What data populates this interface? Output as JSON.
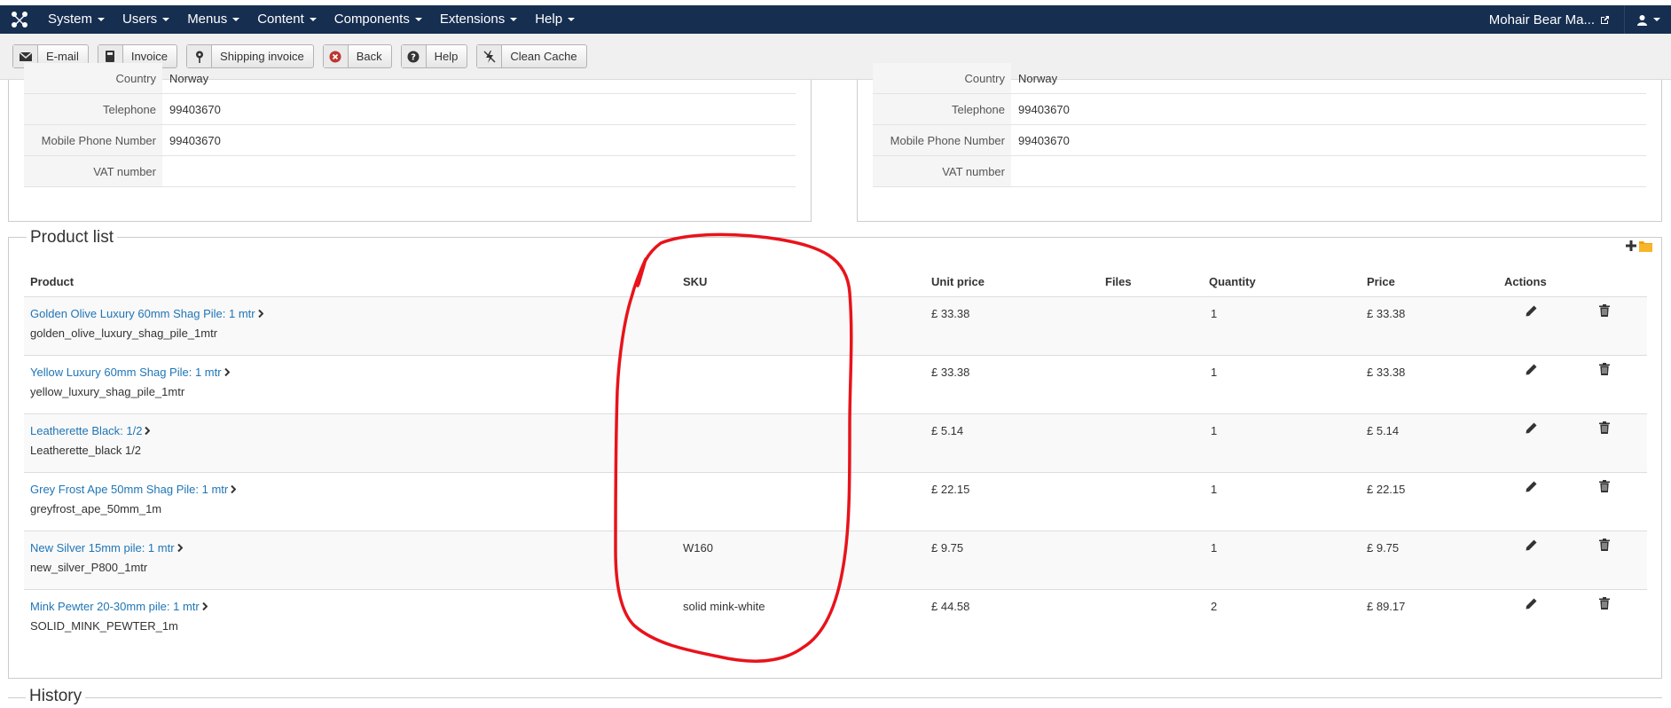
{
  "topbar": {
    "menu": [
      {
        "label": "System"
      },
      {
        "label": "Users"
      },
      {
        "label": "Menus"
      },
      {
        "label": "Content"
      },
      {
        "label": "Components"
      },
      {
        "label": "Extensions"
      },
      {
        "label": "Help"
      }
    ],
    "site_name": "Mohair Bear Ma...",
    "bar_color": "#162e50"
  },
  "toolbar": {
    "buttons": [
      {
        "label": "E-mail",
        "icon": "envelope-icon"
      },
      {
        "label": "Invoice",
        "icon": "book-icon"
      },
      {
        "label": "Shipping invoice",
        "icon": "map-pin-icon"
      },
      {
        "label": "Back",
        "icon": "cancel-circle-icon"
      },
      {
        "label": "Help",
        "icon": "question-circle-icon"
      },
      {
        "label": "Clean Cache",
        "icon": "flash-off-icon"
      }
    ]
  },
  "billing": {
    "rows": [
      {
        "label": "Country",
        "value": "Norway"
      },
      {
        "label": "Telephone",
        "value": "99403670"
      },
      {
        "label": "Mobile Phone Number",
        "value": "99403670"
      },
      {
        "label": "VAT number",
        "value": ""
      }
    ]
  },
  "shipping": {
    "rows": [
      {
        "label": "Country",
        "value": "Norway"
      },
      {
        "label": "Telephone",
        "value": "99403670"
      },
      {
        "label": "Mobile Phone Number",
        "value": "99403670"
      },
      {
        "label": "VAT number",
        "value": ""
      }
    ]
  },
  "product_list": {
    "legend": "Product list",
    "columns": {
      "product": "Product",
      "sku": "SKU",
      "unit_price": "Unit price",
      "files": "Files",
      "quantity": "Quantity",
      "price": "Price",
      "actions": "Actions"
    },
    "rows": [
      {
        "name": "Golden Olive Luxury 60mm Shag Pile: 1 mtr",
        "code": "golden_olive_luxury_shag_pile_1mtr",
        "sku": "",
        "unit_price": "£ 33.38",
        "quantity": "1",
        "price": "£ 33.38"
      },
      {
        "name": "Yellow Luxury 60mm Shag Pile: 1 mtr",
        "code": "yellow_luxury_shag_pile_1mtr",
        "sku": "",
        "unit_price": "£ 33.38",
        "quantity": "1",
        "price": "£ 33.38"
      },
      {
        "name": "Leatherette Black: 1/2",
        "code": "Leatherette_black 1/2",
        "sku": "",
        "unit_price": "£ 5.14",
        "quantity": "1",
        "price": "£ 5.14"
      },
      {
        "name": "Grey Frost Ape 50mm Shag Pile: 1 mtr",
        "code": "greyfrost_ape_50mm_1m",
        "sku": "",
        "unit_price": "£ 22.15",
        "quantity": "1",
        "price": "£ 22.15"
      },
      {
        "name": "New Silver 15mm pile: 1 mtr",
        "code": "new_silver_P800_1mtr",
        "sku": "W160",
        "unit_price": "£ 9.75",
        "quantity": "1",
        "price": "£ 9.75"
      },
      {
        "name": "Mink Pewter 20-30mm pile: 1 mtr",
        "code": "SOLID_MINK_PEWTER_1m",
        "sku": "solid mink-white",
        "unit_price": "£ 44.58",
        "quantity": "2",
        "price": "£ 89.17"
      }
    ]
  },
  "history": {
    "legend": "History"
  },
  "colors": {
    "link": "#1f75b6",
    "annotation": "#e8131b"
  }
}
